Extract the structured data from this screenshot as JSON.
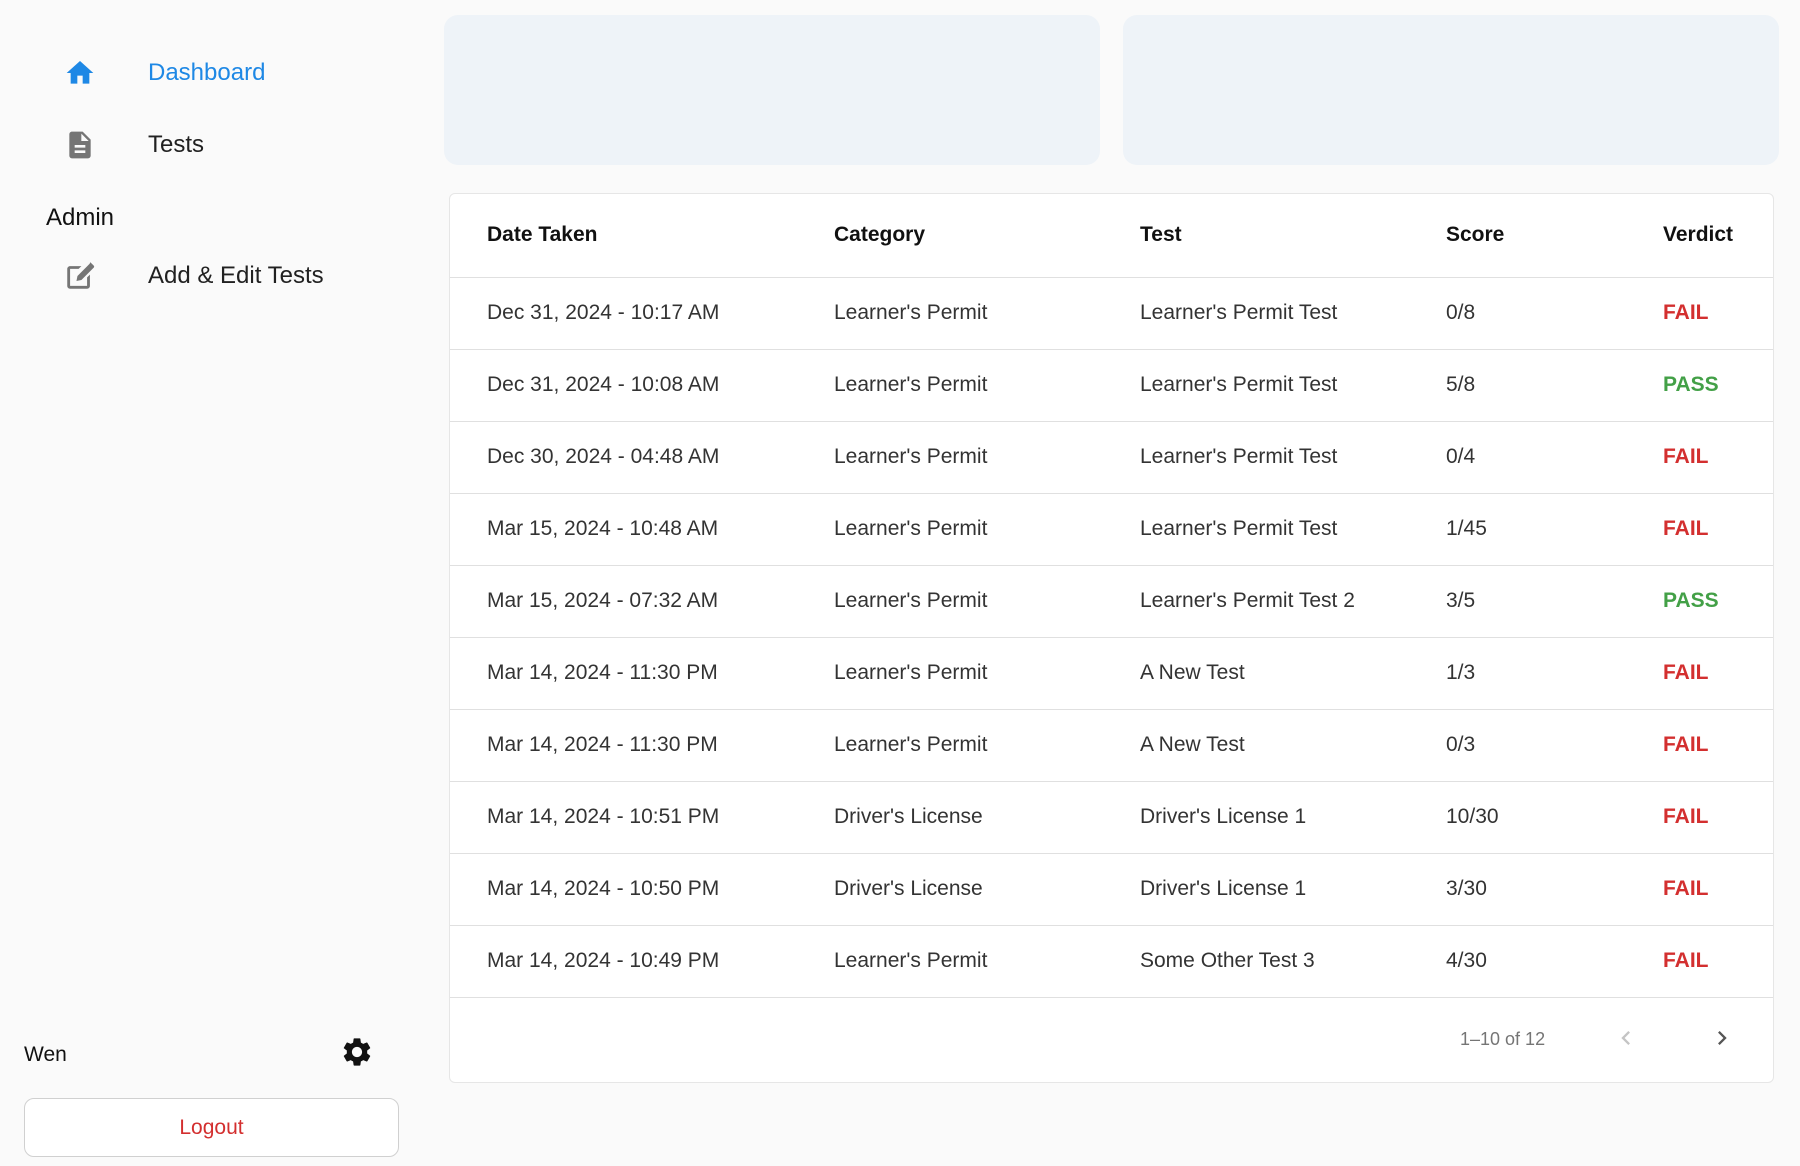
{
  "colors": {
    "accent": "#1e88e5",
    "fail": "#d32f2f",
    "pass": "#43a047",
    "icon_grey": "#757575"
  },
  "sidebar": {
    "items": [
      {
        "label": "Dashboard",
        "icon": "home-icon",
        "active": true
      },
      {
        "label": "Tests",
        "icon": "document-icon",
        "active": false
      }
    ],
    "admin_heading": "Admin",
    "admin_items": [
      {
        "label": "Add & Edit Tests",
        "icon": "edit-icon",
        "active": false
      }
    ],
    "user_name": "Wen",
    "settings_icon": "gear-icon",
    "logout_label": "Logout"
  },
  "table": {
    "headers": [
      "Date Taken",
      "Category",
      "Test",
      "Score",
      "Verdict"
    ],
    "rows": [
      {
        "date": "Dec 31, 2024 - 10:17 AM",
        "category": "Learner's Permit",
        "test": "Learner's Permit Test",
        "score": "0/8",
        "verdict": "FAIL"
      },
      {
        "date": "Dec 31, 2024 - 10:08 AM",
        "category": "Learner's Permit",
        "test": "Learner's Permit Test",
        "score": "5/8",
        "verdict": "PASS"
      },
      {
        "date": "Dec 30, 2024 - 04:48 AM",
        "category": "Learner's Permit",
        "test": "Learner's Permit Test",
        "score": "0/4",
        "verdict": "FAIL"
      },
      {
        "date": "Mar 15, 2024 - 10:48 AM",
        "category": "Learner's Permit",
        "test": "Learner's Permit Test",
        "score": "1/45",
        "verdict": "FAIL"
      },
      {
        "date": "Mar 15, 2024 - 07:32 AM",
        "category": "Learner's Permit",
        "test": "Learner's Permit Test 2",
        "score": "3/5",
        "verdict": "PASS"
      },
      {
        "date": "Mar 14, 2024 - 11:30 PM",
        "category": "Learner's Permit",
        "test": "A New Test",
        "score": "1/3",
        "verdict": "FAIL"
      },
      {
        "date": "Mar 14, 2024 - 11:30 PM",
        "category": "Learner's Permit",
        "test": "A New Test",
        "score": "0/3",
        "verdict": "FAIL"
      },
      {
        "date": "Mar 14, 2024 - 10:51 PM",
        "category": "Driver's License",
        "test": "Driver's License 1",
        "score": "10/30",
        "verdict": "FAIL"
      },
      {
        "date": "Mar 14, 2024 - 10:50 PM",
        "category": "Driver's License",
        "test": "Driver's License 1",
        "score": "3/30",
        "verdict": "FAIL"
      },
      {
        "date": "Mar 14, 2024 - 10:49 PM",
        "category": "Learner's Permit",
        "test": "Some Other Test 3",
        "score": "4/30",
        "verdict": "FAIL"
      }
    ]
  },
  "pagination": {
    "info": "1–10 of 12",
    "prev_icon": "chevron-left-icon",
    "next_icon": "chevron-right-icon"
  }
}
